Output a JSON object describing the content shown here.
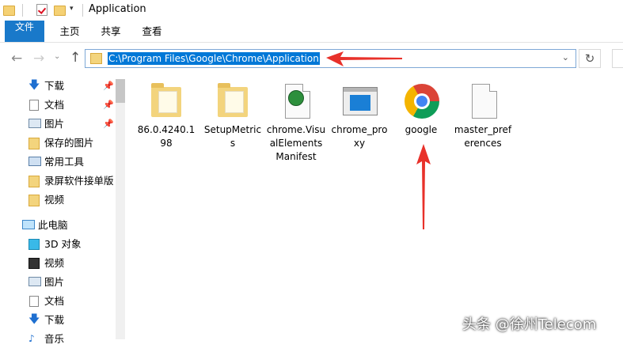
{
  "window": {
    "title": "Application"
  },
  "ribbon": {
    "tabs": [
      "文件",
      "主页",
      "共享",
      "查看"
    ]
  },
  "address": {
    "path": "C:\\Program Files\\Google\\Chrome\\Application"
  },
  "sidebar": {
    "quick_access": [
      {
        "label": "下载",
        "icon": "download-icon",
        "pinned": true
      },
      {
        "label": "文档",
        "icon": "documents-icon",
        "pinned": true
      },
      {
        "label": "图片",
        "icon": "pictures-icon",
        "pinned": true
      },
      {
        "label": "保存的图片",
        "icon": "folder-icon",
        "pinned": false
      },
      {
        "label": "常用工具",
        "icon": "tools-icon",
        "pinned": false
      },
      {
        "label": "录屏软件接单版",
        "icon": "folder-icon",
        "pinned": false
      },
      {
        "label": "视频",
        "icon": "folder-icon",
        "pinned": false
      }
    ],
    "this_pc": {
      "label": "此电脑",
      "icon": "computer-icon"
    },
    "pc_items": [
      {
        "label": "3D 对象",
        "icon": "3d-objects-icon"
      },
      {
        "label": "视频",
        "icon": "videos-icon"
      },
      {
        "label": "图片",
        "icon": "pictures-icon"
      },
      {
        "label": "文档",
        "icon": "documents-icon"
      },
      {
        "label": "下载",
        "icon": "download-icon"
      },
      {
        "label": "音乐",
        "icon": "music-icon"
      }
    ]
  },
  "files": [
    {
      "name": "86.0.4240.198",
      "icon": "folder-icon"
    },
    {
      "name": "SetupMetrics",
      "icon": "folder-icon"
    },
    {
      "name": "chrome.VisualElementsManifest",
      "icon": "manifest-file-icon"
    },
    {
      "name": "chrome_proxy",
      "icon": "app-window-icon"
    },
    {
      "name": "google",
      "icon": "chrome-icon"
    },
    {
      "name": "master_preferences",
      "icon": "blank-file-icon"
    }
  ],
  "annotation_color": "#e8312a",
  "accent_color": "#1979ca",
  "watermark": "头条 @徐州Telecom"
}
